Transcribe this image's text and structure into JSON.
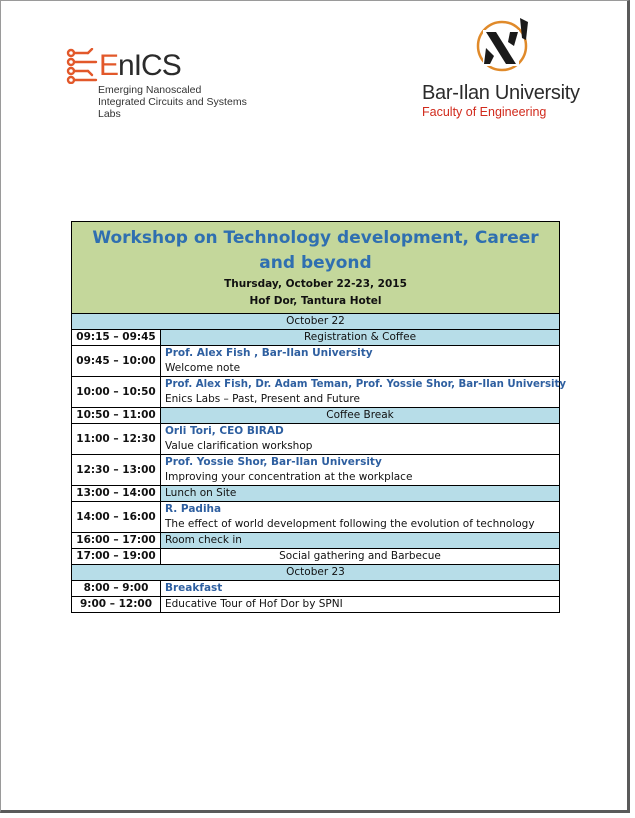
{
  "logos": {
    "enics": {
      "name_first": "E",
      "name_rest": "nICS",
      "line1": "Emerging Nanoscaled",
      "line2": "Integrated Circuits and Systems Labs",
      "accent": "#e2582a"
    },
    "biu": {
      "name": "Bar-Ilan University",
      "faculty": "Faculty of Engineering",
      "accent": "#d12a1c"
    }
  },
  "header": {
    "title": "Workshop on Technology development, Career and beyond",
    "date": "Thursday, October 22-23, 2015",
    "venue": "Hof Dor, Tantura Hotel",
    "background": "#c4d79b",
    "title_color": "#2f6fb0"
  },
  "days": [
    {
      "label": "October 22",
      "sessions": [
        {
          "time": "09:15 – 09:45",
          "title": "Registration & Coffee"
        },
        {
          "time": "09:45 – 10:00",
          "speaker": "Prof. Alex Fish , Bar-Ilan University",
          "title": "Welcome note"
        },
        {
          "time": "10:00 – 10:50",
          "speaker": "Prof. Alex Fish, Dr. Adam Teman, Prof. Yossie Shor, Bar-Ilan University",
          "title": "Enics Labs – Past, Present and Future"
        },
        {
          "time": "10:50 – 11:00",
          "title": "Coffee Break"
        },
        {
          "time": "11:00 – 12:30",
          "speaker": "Orli Tori, CEO BIRAD",
          "title": "Value clarification workshop"
        },
        {
          "time": "12:30 – 13:00",
          "speaker": "Prof. Yossie Shor, Bar-Ilan University",
          "title": "Improving your concentration at the workplace"
        },
        {
          "time": "13:00 – 14:00",
          "title": "Lunch on Site"
        },
        {
          "time": "14:00 – 16:00",
          "speaker": "R. Padiha",
          "title": "The effect of world development following the evolution of technology"
        },
        {
          "time": "16:00 – 17:00",
          "title": "Room check in"
        },
        {
          "time": "17:00 – 19:00",
          "title": "Social gathering and Barbecue"
        }
      ]
    },
    {
      "label": "October 23",
      "sessions": [
        {
          "time": "8:00 – 9:00",
          "title": "Breakfast"
        },
        {
          "time": "9:00 – 12:00",
          "title": "Educative Tour of Hof Dor by SPNI"
        }
      ]
    }
  ],
  "colors": {
    "highlight": "#b7dde8",
    "speaker": "#2e5fa0"
  }
}
